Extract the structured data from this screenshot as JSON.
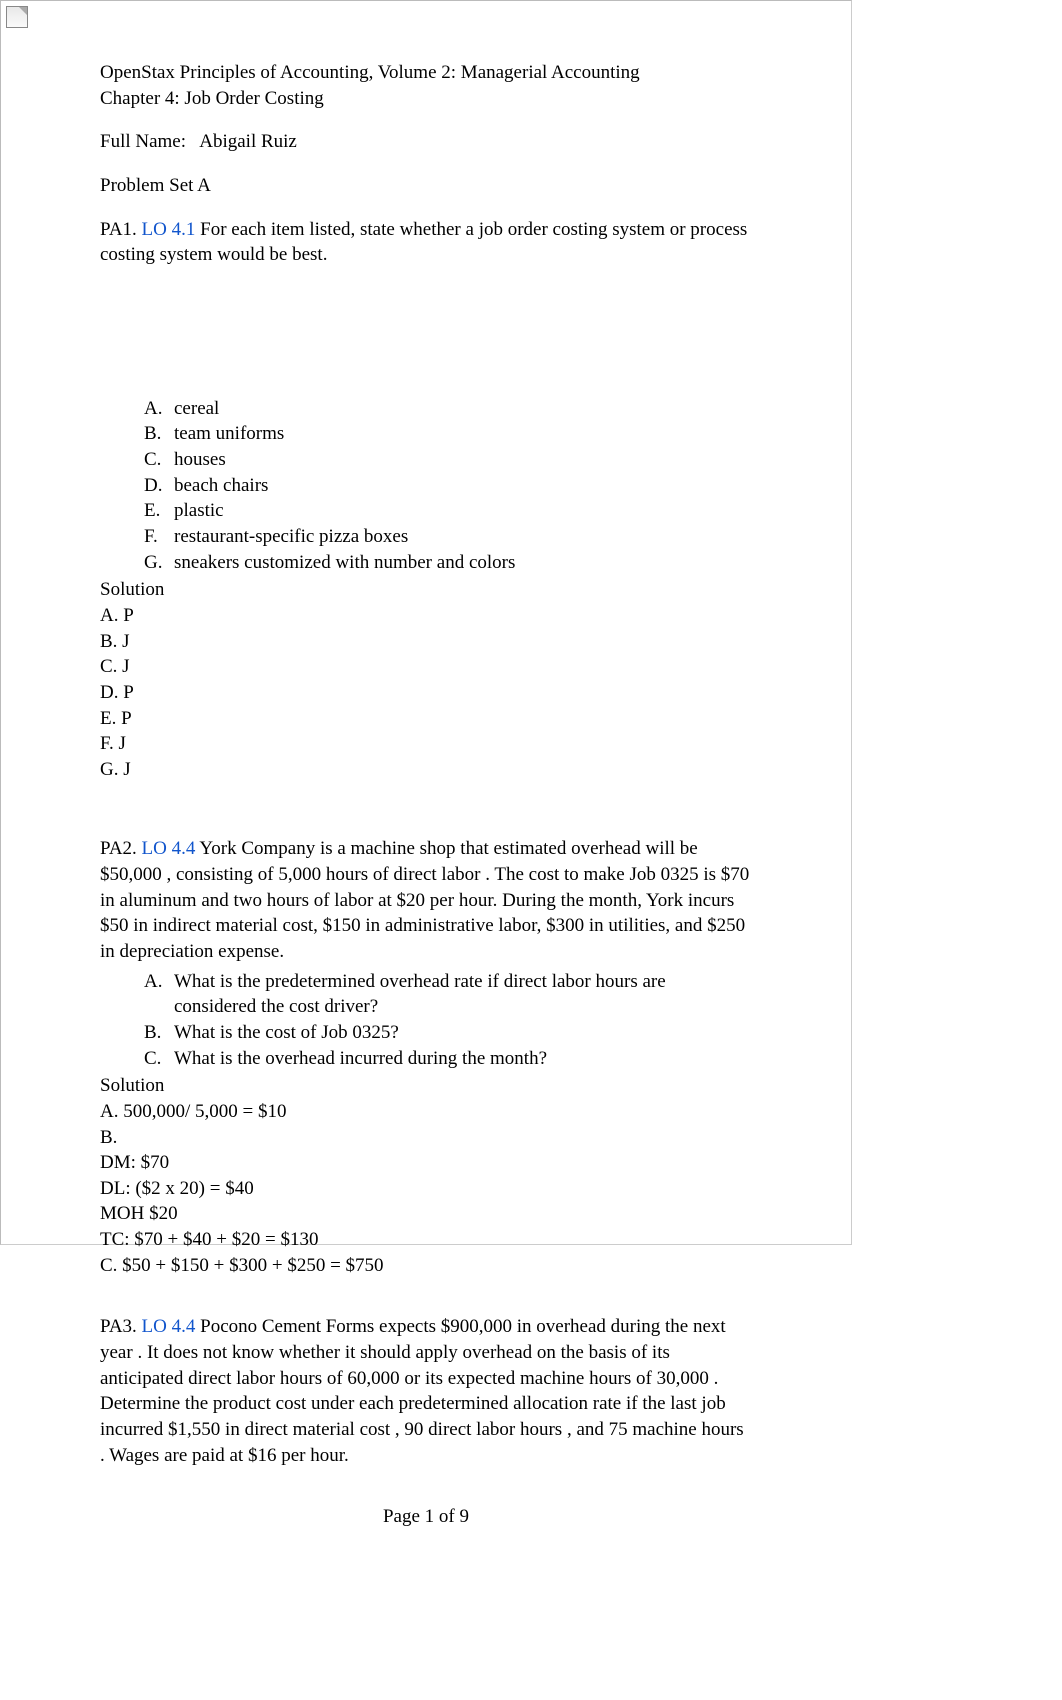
{
  "header": {
    "line1": "OpenStax Principles of Accounting, Volume 2: Managerial Accounting",
    "line2": "Chapter 4: Job Order Costing",
    "name_label": "Full Name:",
    "name_value": "Abigail Ruiz",
    "set_label": "Problem Set A"
  },
  "pa1": {
    "number": "PA1.",
    "lo": "LO 4.1",
    "prompt": " For each item listed, state whether a job order costing system or process costing system would be best.",
    "items": [
      {
        "marker": "A.",
        "text": "cereal"
      },
      {
        "marker": "B.",
        "text": "team uniforms"
      },
      {
        "marker": "C.",
        "text": "houses"
      },
      {
        "marker": "D.",
        "text": "beach chairs"
      },
      {
        "marker": "E.",
        "text": "plastic"
      },
      {
        "marker": "F.",
        "text": "restaurant-specific pizza boxes"
      },
      {
        "marker": "G.",
        "text": "sneakers customized with number and colors"
      }
    ],
    "solution_label": "Solution",
    "solution": [
      "A. P",
      "B. J",
      "C. J",
      "D. P",
      "E. P",
      "F. J",
      "G. J"
    ]
  },
  "pa2": {
    "number": "PA2.",
    "lo": "LO 4.4",
    "prompt": " York Company is a machine shop that estimated overhead will be $50,000  , consisting of 5,000 hours of direct labor  . The cost to make Job 0325 is $70 in aluminum  and two hours of labor   at $20 per hour.   During the month, York incurs $50 in indirect material cost, $150 in administrative labor, $300 in utilities,     and $250 in depreciation expense.",
    "items": [
      {
        "marker": "A.",
        "text": "What is the predetermined overhead rate if direct labor hours are considered the cost driver?"
      },
      {
        "marker": "B.",
        "text": "What is the cost of Job 0325?"
      },
      {
        "marker": "C.",
        "text": "What is the overhead incurred during the month?"
      }
    ],
    "solution_label": "Solution",
    "solution": [
      "A. 500,000/ 5,000 = $10",
      "B.",
      "DM: $70",
      "DL: ($2 x 20) = $40",
      "MOH $20",
      "TC: $70 + $40 + $20 = $130",
      "C. $50 + $150 + $300 + $250 = $750"
    ]
  },
  "pa3": {
    "number": "PA3.",
    "lo": "LO 4.4",
    "prompt": " Pocono Cement Forms expects $900,000 in overhead during the next year   . It does not know whether it should apply overhead on the basis of its anticipated direct labor hours of 60,000  or its expected machine hours of 30,000  . Determine the product cost under each predetermined allocation rate if the last job incurred $1,550 in direct material cost   , 90 direct labor hours  , and 75 machine hours . Wages are paid at $16 per hour."
  },
  "footer": {
    "page_number": "Page 1 of 9"
  }
}
